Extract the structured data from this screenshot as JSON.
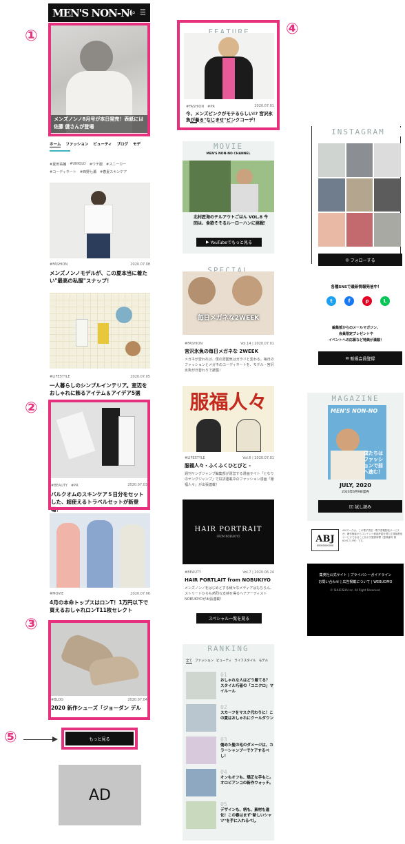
{
  "header": {
    "logo": "MEN'S NON-NO WEB",
    "search_icon": "search-icon",
    "menu_icon": "hamburger-icon"
  },
  "callouts": {
    "c1": "①",
    "c2": "②",
    "c3": "③",
    "c4": "④",
    "c5": "⑤"
  },
  "hero": {
    "title": "メンズノンノ8月号が本日発売！表紙には佐藤 健さんが登場"
  },
  "nav": [
    "ホーム",
    "ファッション",
    "ビューティ",
    "ブログ",
    "モデ"
  ],
  "tags": [
    [
      "#夏田祐輔",
      "#UNIQLO",
      "#ウチ服",
      "#スニーカー"
    ],
    [
      "#コーディネート",
      "#西野七瀬",
      "#春夏スキンケア"
    ]
  ],
  "articles": [
    {
      "tag": "#FASHION",
      "date": "2020.07.08",
      "title": "メンズノンノモデルが、この夏本当に着たい\"最高の私服\"スナップ！"
    },
    {
      "tag": "#LIFESTYLE",
      "date": "2020.07.05",
      "title": "一人暮らしのシンプルインテリア。室辺をおしゃれに飾るアイテム＆アイデア5選"
    },
    {
      "tag": "#BEAUTY",
      "tag2": "#PR",
      "date": "2020.07.03",
      "title": "バルクオムのスキンケア５日分をセットした、超使えるトラベルセットが新登場！"
    },
    {
      "tag": "#MOVIE",
      "date": "2020.07.06",
      "title": "4月の本命トップスはロンT！1万円以下で買えるおしゃれロンT11枚セレクト"
    },
    {
      "tag": "#BLOG",
      "date": "2020.07.04",
      "title": "2020 新作シューズ「ジョーダン デルタ」"
    }
  ],
  "more_label": "もっと見る",
  "ad_label": "AD",
  "feature": {
    "heading": "FEATURE",
    "tag": "#FASHION",
    "tag2": "#PR",
    "date": "2020.07.01",
    "title": "今、メンズピンクがモテるらしい!? 宮沢氷魚が着る\"なじませ\"ピンクコーデ！"
  },
  "movie": {
    "heading": "MOVIE",
    "sub": "MEN'S NON-NO CHANNEL",
    "title": "北村匠海のチルアウトごはん VOL.8 今回は、食欲そそるルーローハンに挑戦！",
    "button": "YouTubeでもっと見る"
  },
  "special": {
    "heading": "SPECIAL",
    "img_text": "毎日メガネな2WEEK",
    "tag": "#FASHION",
    "meta": "Vol.14 | 2020.07.01",
    "title": "宮沢氷魚の毎日メガネな 2WEEK",
    "desc": "メガネが変われば、僕の雰囲気はガラリと変わる。毎日のファッションとメガネのコーディネートを、モデル・宮沢氷魚が日替わりで披露！"
  },
  "fuku": {
    "img_text": "服福人々",
    "tag": "#LIFESTYLE",
    "meta": "Vol.6 | 2020.07.01",
    "title": "服福人々・ふくふくひとびと -",
    "desc": "週刊ヤングジャンプ編集部が運営する漫画サイト「となりのヤングジャンプ」で好評連載中のファッション漫画「服福人々」が出張連載！"
  },
  "hair": {
    "img_text": "HAIR PORTRAIT",
    "img_sub": "FROM NOBUKIYO",
    "tag": "#BEAUTY",
    "meta": "Vol.7 | 2020.06.24",
    "title": "HAIR PORTLAIT from NOBUKIYO",
    "desc": "メンズノンノをはじめとする様々なメディアはもちろん、ストリートからも熱烈な支持を得るヘアアーティスト NOBUKIYOが出張連載！",
    "button": "スペシャル一覧を見る"
  },
  "ranking": {
    "heading": "RANKING",
    "tabs": [
      "全て",
      "ファッション",
      "ビューティ",
      "ライフスタイル",
      "モデル"
    ],
    "items": [
      {
        "no": "01",
        "title": "おしゃれな人はどう着てる？ スタイル巧者の「ユニクロ」マイルール"
      },
      {
        "no": "02",
        "title": "スカーフをマスク代わりに！この夏はおしゃれにクールダウン"
      },
      {
        "no": "03",
        "title": "傷めた髪の毛のダメージは、カラーシャンプーでケアするべし！"
      },
      {
        "no": "04",
        "title": "オンもオフも、矯正な手もと。オロビアンコの新作ウォッチ。"
      },
      {
        "no": "05",
        "title": "デザインも、柄も、素材も進化！この春はまず\"新しいシャツ\"を手に入れるべし"
      }
    ]
  },
  "instagram": {
    "heading": "INSTAGRAM",
    "follow": "フォローする"
  },
  "sns": {
    "lead": "各種SNSで最新情報発信中！",
    "mail_text1": "編集部からのメールマガジン、",
    "mail_text2": "会員限定プレゼントや",
    "mail_text3": "イベントへの応募など特典が満載！",
    "register": "新規会員登録"
  },
  "magazine": {
    "heading": "MAGAZINE",
    "cover_logo": "MEN'S NON-NO",
    "cover_text": "僕たちはファッションで前へ進む！",
    "issue": "JULY, 2020",
    "release": "2020年6月9日発売",
    "read": "試し読み"
  },
  "abj": {
    "logo": "ABJ",
    "number": "00000000000",
    "text": "ABJマークは、この電子書店・電子書籍配信サービスが、著作権者からコンテンツ使用許諾を得た正規版配信サービスであることを示す登録商標（登録番号 第6091713号）です。"
  },
  "footer": {
    "links1": "集英社公式サイト | プライバシーガイドライン",
    "links2": "お問い合わせ | 広告掲載について | WEBUOMO",
    "copyright": "© SHUEISHA Inc. All Right Reserved."
  }
}
